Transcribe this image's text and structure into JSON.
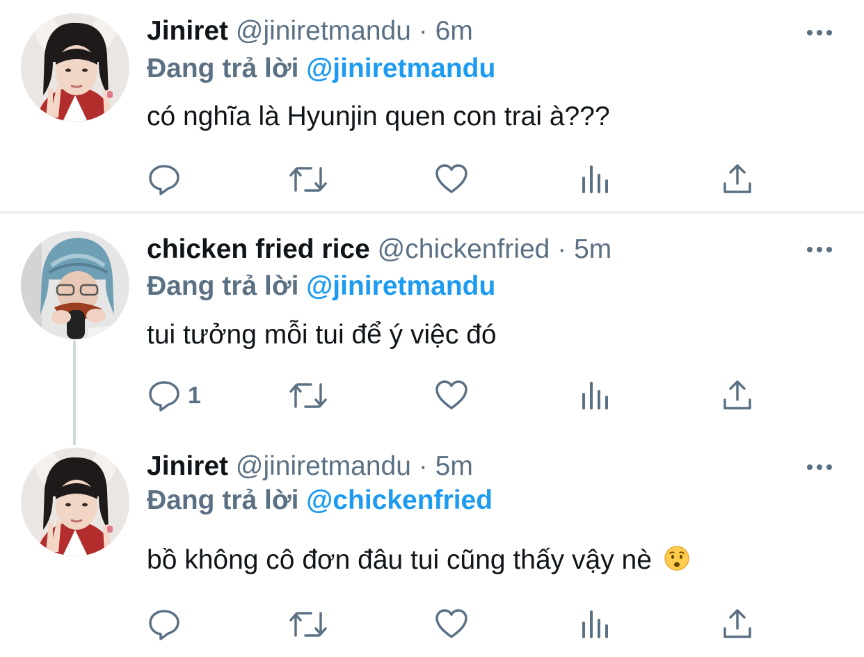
{
  "tweets": [
    {
      "name": "Jiniret",
      "handle": "@jiniretmandu",
      "separator": "·",
      "time": "6m",
      "replying_prefix": "Đang trả lời",
      "replying_to": "@jiniretmandu",
      "text": "có nghĩa là Hyunjin quen con trai à???",
      "reply_count": ""
    },
    {
      "name": "chicken fried rice",
      "handle": "@chickenfried",
      "separator": "·",
      "time": "5m",
      "replying_prefix": "Đang trả lời",
      "replying_to": "@jiniretmandu",
      "text": "tui tưởng mỗi tui để ý việc đó",
      "reply_count": "1"
    },
    {
      "name": "Jiniret",
      "handle": "@jiniretmandu",
      "separator": "·",
      "time": "5m",
      "replying_prefix": "Đang trả lời",
      "replying_to": "@chickenfried",
      "text": "bồ không cô đơn đâu tui cũng thấy vậy nè",
      "reply_count": ""
    }
  ],
  "icons": {
    "reply": "reply-icon",
    "retweet": "retweet-icon",
    "like": "heart-icon",
    "stats": "analytics-icon",
    "share": "share-icon",
    "more": "more-options-icon",
    "emoji": "hushed-face-emoji"
  },
  "colors": {
    "mention": "#1d9bf0",
    "secondary_text": "#5b7083",
    "divider": "#e6ecf0",
    "thread_line": "#cfd9de"
  }
}
